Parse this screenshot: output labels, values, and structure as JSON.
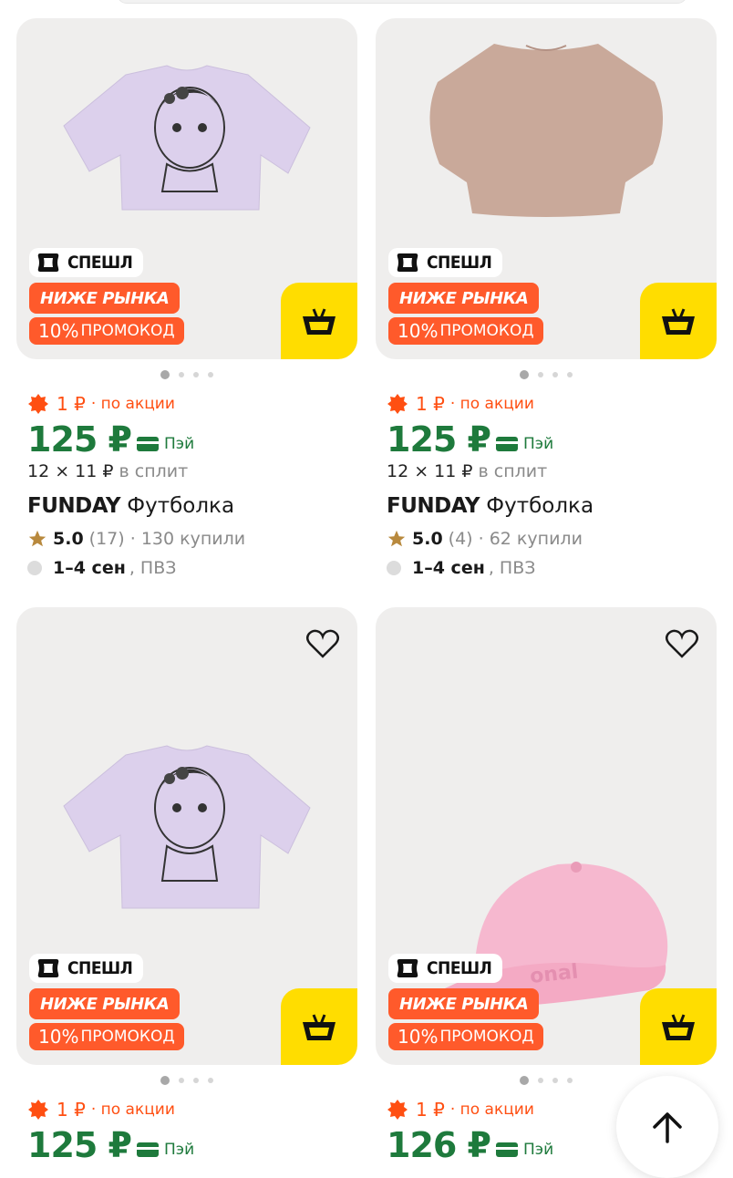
{
  "products": [
    {
      "brand": "FUNDAY",
      "name": "Футболка",
      "badge_special": "СПЕШЛ",
      "badge_market": "НИЖЕ РЫНКА",
      "promo_percent": "10%",
      "promo_word": "ПРОМОКОД",
      "promo_price": "1 ₽",
      "promo_text": "· по акции",
      "price": "125 ₽",
      "pay_label": "Пэй",
      "split_value": "12 × 11 ₽",
      "split_text": "в сплит",
      "rating": "5.0",
      "reviews": "(17)",
      "bought": "· 130 купили",
      "delivery_days": "1–4 сен",
      "delivery_text": ", ПВЗ",
      "image": "lilac-anime-tshirt"
    },
    {
      "brand": "FUNDAY",
      "name": "Футболка",
      "badge_special": "СПЕШЛ",
      "badge_market": "НИЖЕ РЫНКА",
      "promo_percent": "10%",
      "promo_word": "ПРОМОКОД",
      "promo_price": "1 ₽",
      "promo_text": "· по акции",
      "price": "125 ₽",
      "pay_label": "Пэй",
      "split_value": "12 × 11 ₽",
      "split_text": "в сплит",
      "rating": "5.0",
      "reviews": "(4)",
      "bought": "· 62 купили",
      "delivery_days": "1–4 сен",
      "delivery_text": ", ПВЗ",
      "image": "beige-cropped-top"
    },
    {
      "badge_special": "СПЕШЛ",
      "badge_market": "НИЖЕ РЫНКА",
      "promo_percent": "10%",
      "promo_word": "ПРОМОКОД",
      "promo_price": "1 ₽",
      "promo_text": "· по акции",
      "price": "125 ₽",
      "pay_label": "Пэй",
      "image": "lilac-anime-tshirt"
    },
    {
      "badge_special": "СПЕШЛ",
      "badge_market": "НИЖЕ РЫНКА",
      "promo_percent": "10%",
      "promo_word": "ПРОМОКОД",
      "promo_price": "1 ₽",
      "promo_text": "· по акции",
      "price": "126 ₽",
      "pay_label": "Пэй",
      "image": "pink-cap",
      "cap_text": "onal"
    }
  ],
  "icons": {
    "favorite": "heart-icon",
    "cart": "basket-icon",
    "scroll_top": "arrow-up-icon",
    "special": "special-logo-icon",
    "promo": "sun-badge-icon",
    "rating": "star-icon",
    "pay": "card-icon"
  },
  "colors": {
    "price_green": "#1e7a3c",
    "promo_orange": "#ff4f12",
    "badge_orange": "#ff5a2b",
    "cart_yellow": "#ffdd00",
    "star_gold": "#b8893d"
  }
}
